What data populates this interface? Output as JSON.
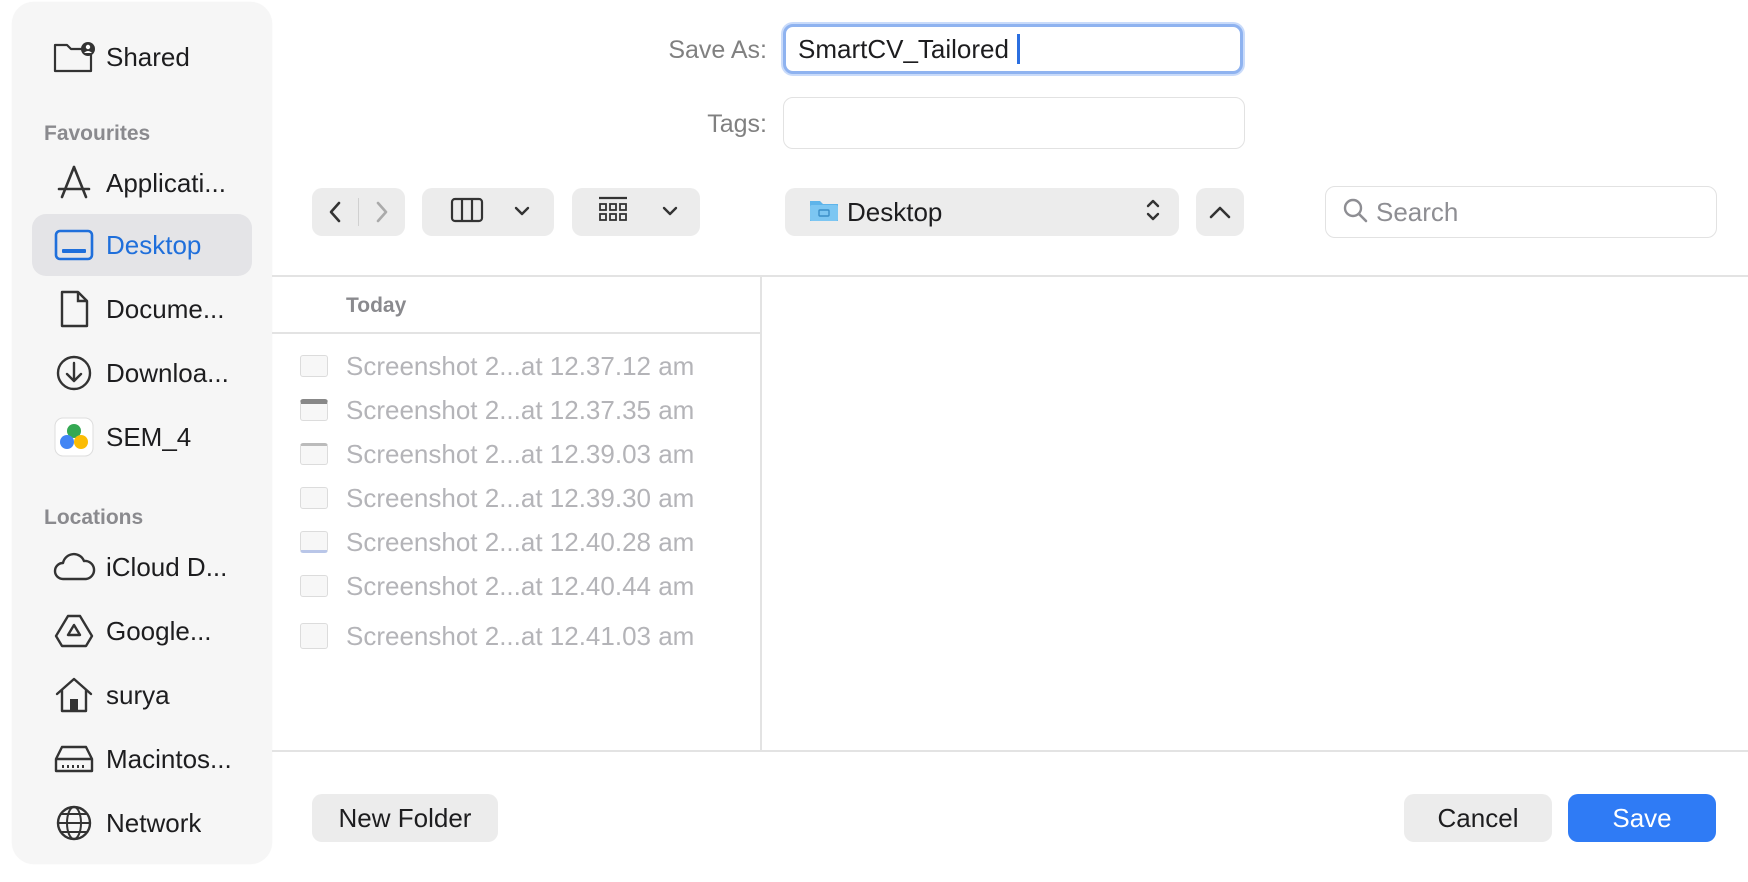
{
  "sidebar": {
    "shared_label": "Shared",
    "favourites_header": "Favourites",
    "favourites": [
      {
        "label": "Applicati...",
        "icon": "applications-icon"
      },
      {
        "label": "Desktop",
        "icon": "desktop-icon",
        "selected": true
      },
      {
        "label": "Docume...",
        "icon": "document-icon"
      },
      {
        "label": "Downloa...",
        "icon": "download-icon"
      },
      {
        "label": "SEM_4",
        "icon": "google-drive-color-icon"
      }
    ],
    "locations_header": "Locations",
    "locations": [
      {
        "label": "iCloud D...",
        "icon": "cloud-icon"
      },
      {
        "label": "Google...",
        "icon": "google-drive-icon"
      },
      {
        "label": "surya",
        "icon": "home-icon"
      },
      {
        "label": "Macintos...",
        "icon": "hard-drive-icon"
      },
      {
        "label": "Network",
        "icon": "globe-icon"
      }
    ]
  },
  "form": {
    "save_as_label": "Save As:",
    "save_as_value": "SmartCV_Tailored",
    "tags_label": "Tags:",
    "tags_value": ""
  },
  "toolbar": {
    "location": "Desktop",
    "search_placeholder": "Search"
  },
  "browser": {
    "section_header": "Today",
    "files": [
      "Screenshot 2...at 12.37.12 am",
      "Screenshot 2...at 12.37.35 am",
      "Screenshot 2...at 12.39.03 am",
      "Screenshot 2...at 12.39.30 am",
      "Screenshot 2...at 12.40.28 am",
      "Screenshot 2...at 12.40.44 am",
      "Screenshot 2...at 12.41.03 am"
    ]
  },
  "buttons": {
    "new_folder": "New Folder",
    "cancel": "Cancel",
    "save": "Save"
  },
  "colors": {
    "accent": "#2f7bf5",
    "selected_text": "#1f6fdb"
  }
}
